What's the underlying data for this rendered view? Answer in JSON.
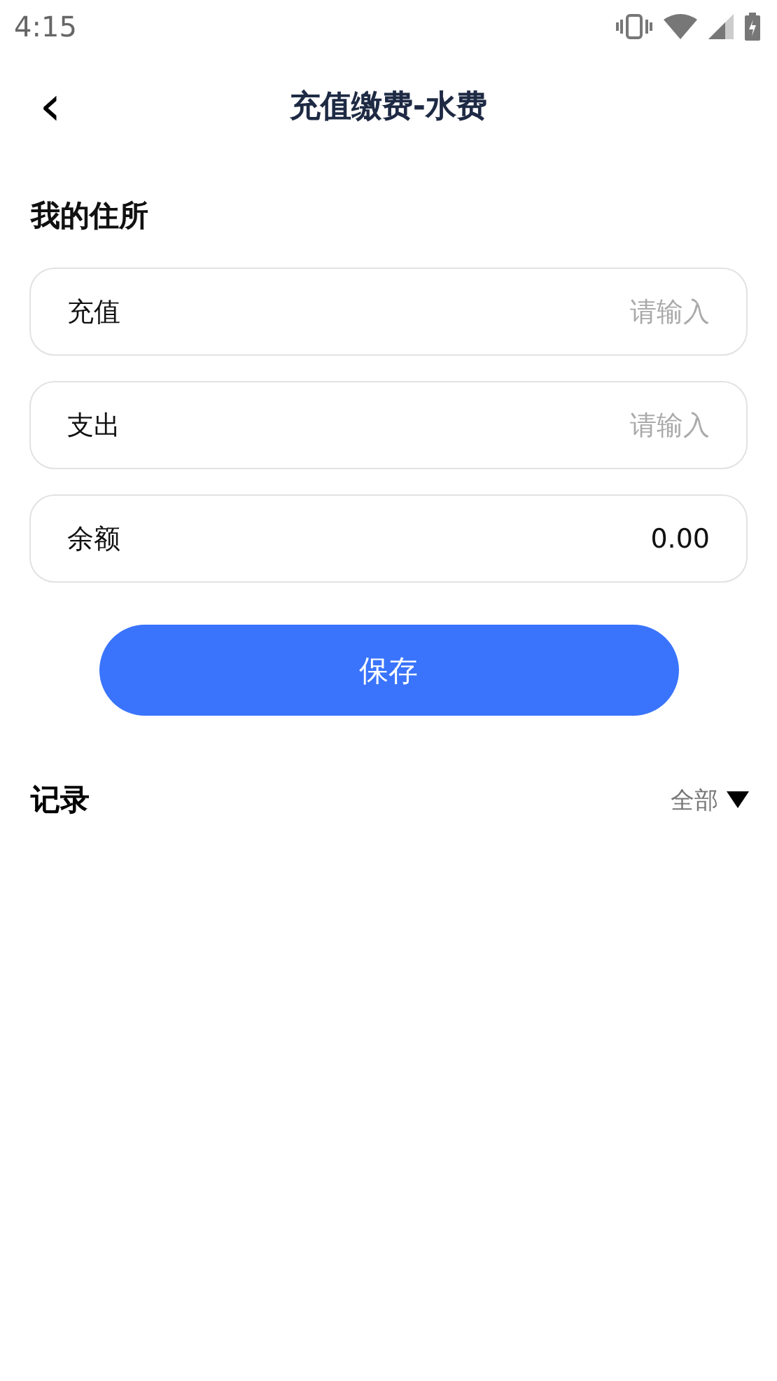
{
  "status_bar": {
    "time": "4:15"
  },
  "header": {
    "back_icon": "‹",
    "title": "充值缴费-水费"
  },
  "residence": {
    "title": "我的住所",
    "fields": [
      {
        "label": "充值",
        "placeholder": "请输入"
      },
      {
        "label": "支出",
        "placeholder": "请输入"
      },
      {
        "label": "余额",
        "value": "0.00"
      }
    ]
  },
  "save_button": "保存",
  "records": {
    "title": "记录",
    "filter": "全部"
  }
}
